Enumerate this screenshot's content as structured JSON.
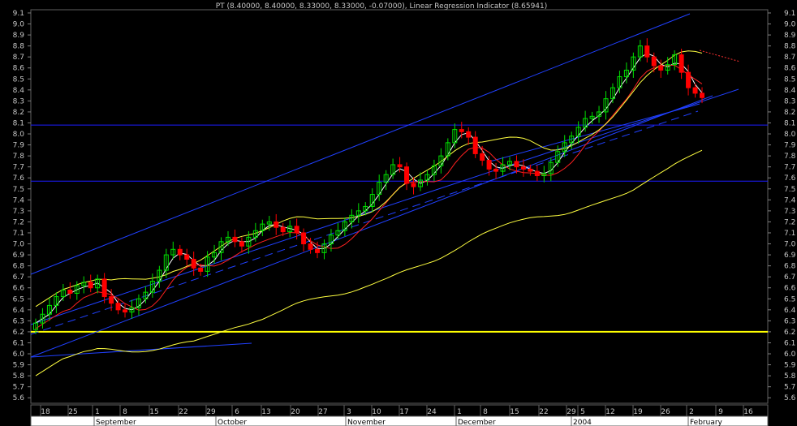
{
  "chart_data": {
    "type": "candlestick",
    "title": "PT (8.40000, 8.40000, 8.33000, 8.33000, -0.07000), Linear Regression Indicator (8.65941)",
    "ylim": [
      5.55,
      9.15
    ],
    "y_ticks": [
      "5.6",
      "5.7",
      "5.8",
      "5.9",
      "6.0",
      "6.1",
      "6.2",
      "6.3",
      "6.4",
      "6.5",
      "6.6",
      "6.7",
      "6.8",
      "6.9",
      "7.0",
      "7.1",
      "7.2",
      "7.3",
      "7.4",
      "7.5",
      "7.6",
      "7.7",
      "7.8",
      "7.9",
      "8.0",
      "8.1",
      "8.2",
      "8.3",
      "8.4",
      "8.5",
      "8.6",
      "8.7",
      "8.8",
      "8.9",
      "9.0",
      "9.1"
    ],
    "x_day_ticks": [
      "18",
      "25",
      "1",
      "8",
      "15",
      "22",
      "29",
      "6",
      "13",
      "20",
      "27",
      "3",
      "10",
      "17",
      "24",
      "1",
      "8",
      "15",
      "22",
      "29",
      "5",
      "12",
      "19",
      "26",
      "2",
      "9",
      "16"
    ],
    "x_month_labels": [
      "September",
      "October",
      "November",
      "December",
      "2004",
      "February"
    ],
    "horizontal_levels": [
      {
        "value": 8.08,
        "color": "#1c1cff"
      },
      {
        "value": 7.57,
        "color": "#1c1cff"
      },
      {
        "value": 6.2,
        "color": "#ffff00"
      }
    ],
    "series": [
      {
        "type": "candles",
        "up_color": "#00e000",
        "down_color": "#ff0000",
        "closes": [
          6.28,
          6.36,
          6.44,
          6.52,
          6.58,
          6.55,
          6.62,
          6.65,
          6.6,
          6.68,
          6.52,
          6.46,
          6.4,
          6.38,
          6.42,
          6.5,
          6.56,
          6.66,
          6.76,
          6.9,
          6.95,
          6.9,
          6.86,
          6.78,
          6.75,
          6.88,
          6.92,
          7.02,
          7.06,
          7.02,
          6.98,
          7.06,
          7.12,
          7.18,
          7.2,
          7.15,
          7.11,
          7.16,
          7.1,
          7.0,
          6.95,
          6.92,
          7.0,
          7.08,
          7.12,
          7.2,
          7.26,
          7.3,
          7.34,
          7.45,
          7.56,
          7.63,
          7.72,
          7.7,
          7.55,
          7.52,
          7.58,
          7.63,
          7.71,
          7.8,
          7.92,
          8.04,
          8.02,
          7.97,
          7.82,
          7.76,
          7.68,
          7.66,
          7.72,
          7.75,
          7.7,
          7.68,
          7.66,
          7.62,
          7.64,
          7.74,
          7.84,
          7.92,
          7.98,
          8.06,
          8.14,
          8.16,
          8.2,
          8.32,
          8.42,
          8.52,
          8.58,
          8.7,
          8.8,
          8.7,
          8.62,
          8.58,
          8.63,
          8.72,
          8.56,
          8.42,
          8.37,
          8.33
        ]
      }
    ],
    "lines": [
      {
        "name": "",
        "color": "#ffffff"
      },
      {
        "name": "",
        "color": "#ff2020"
      },
      {
        "name": "",
        "color": "#ffff40"
      }
    ]
  }
}
